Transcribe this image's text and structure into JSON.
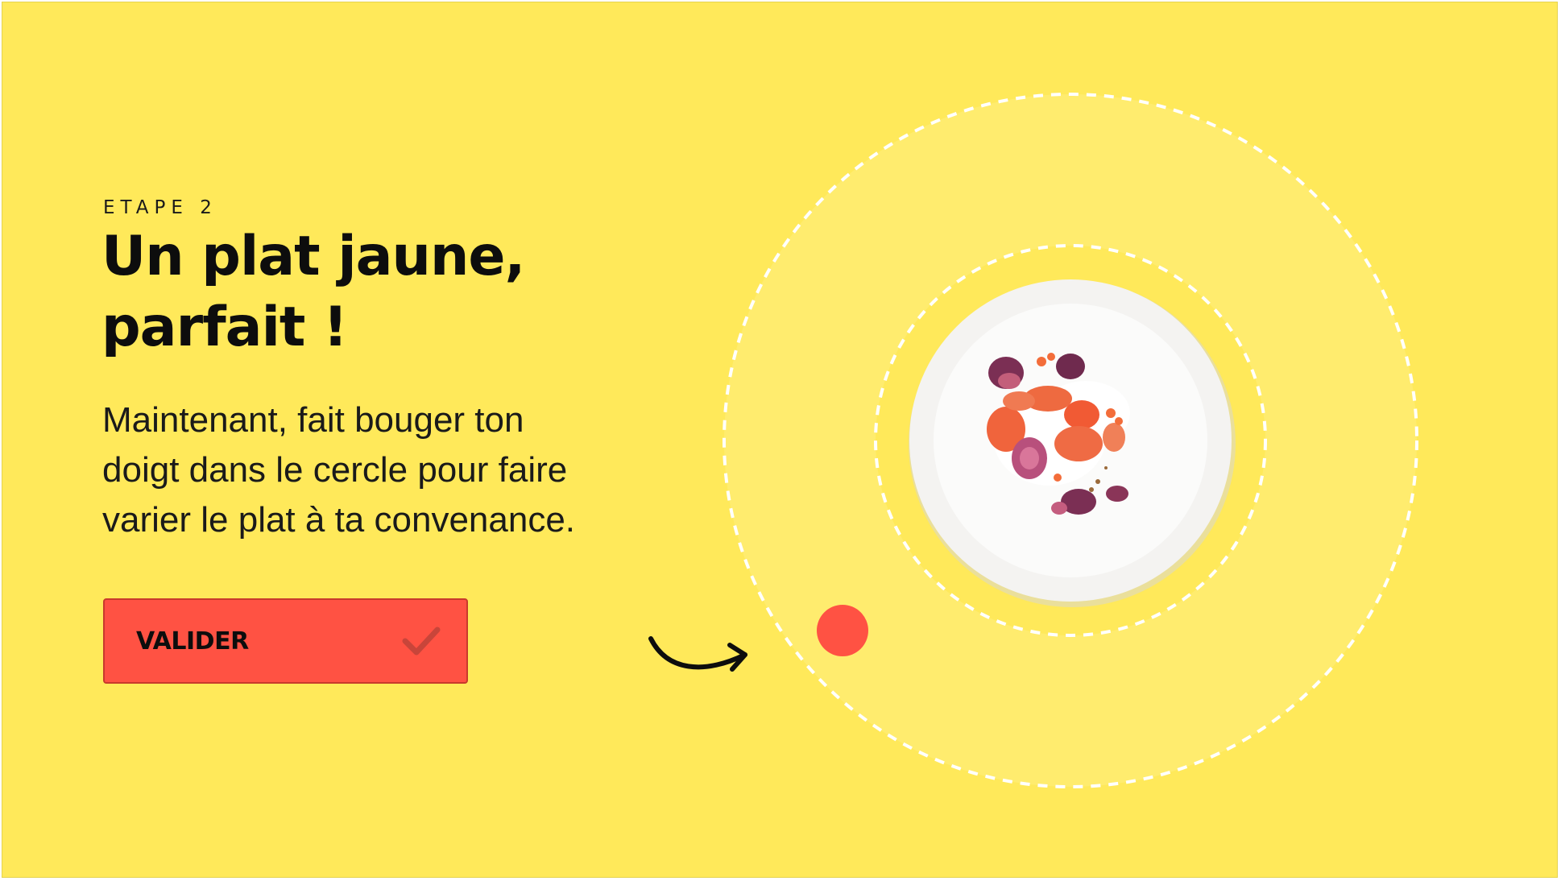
{
  "step": {
    "label": "ETAPE 2"
  },
  "heading": {
    "lines": [
      "Un plat jaune,",
      "parfait !"
    ]
  },
  "instructions": {
    "lines": [
      "Maintenant, fait bouger ton",
      "doigt dans le cercle pour faire",
      "varier le plat à ta convenance."
    ]
  },
  "validate_button": {
    "label": "VALIDER",
    "icon": "check-icon"
  },
  "colors": {
    "background": "#ffe95a",
    "button": "#ff5243",
    "handle": "#ff5243",
    "dashed_rings": "#ffffff",
    "text": "#0d0d0d"
  },
  "visual": {
    "plate_image": "plated-dish-photo",
    "handle": "drag-handle-dot",
    "hint_icon": "curved-arrow-icon"
  }
}
